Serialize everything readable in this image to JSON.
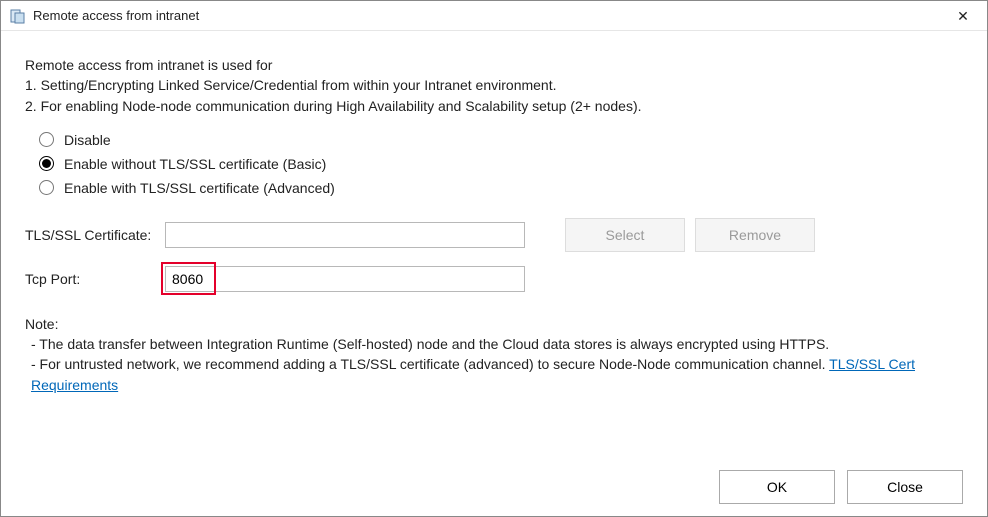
{
  "titlebar": {
    "title": "Remote access from intranet"
  },
  "intro": {
    "line1": "Remote access from intranet is used for",
    "line2": "1. Setting/Encrypting Linked Service/Credential from within your Intranet environment.",
    "line3": "2. For enabling Node-node communication during High Availability and Scalability setup (2+ nodes)."
  },
  "radios": {
    "disable": "Disable",
    "basic": "Enable without TLS/SSL certificate (Basic)",
    "advanced": "Enable with TLS/SSL certificate (Advanced)",
    "selected": "basic"
  },
  "form": {
    "tls_label": "TLS/SSL Certificate:",
    "tls_value": "",
    "tcp_label": "Tcp Port:",
    "tcp_value": "8060",
    "select_btn": "Select",
    "remove_btn": "Remove"
  },
  "note": {
    "heading": "Note:",
    "line1": " - The data transfer between Integration Runtime (Self-hosted) node and the Cloud data stores is always encrypted using HTTPS.",
    "line2_prefix": " - For untrusted network, we recommend adding a TLS/SSL certificate (advanced) to secure Node-Node communication channel. ",
    "link": "TLS/SSL Cert Requirements"
  },
  "footer": {
    "ok": "OK",
    "close": "Close"
  }
}
